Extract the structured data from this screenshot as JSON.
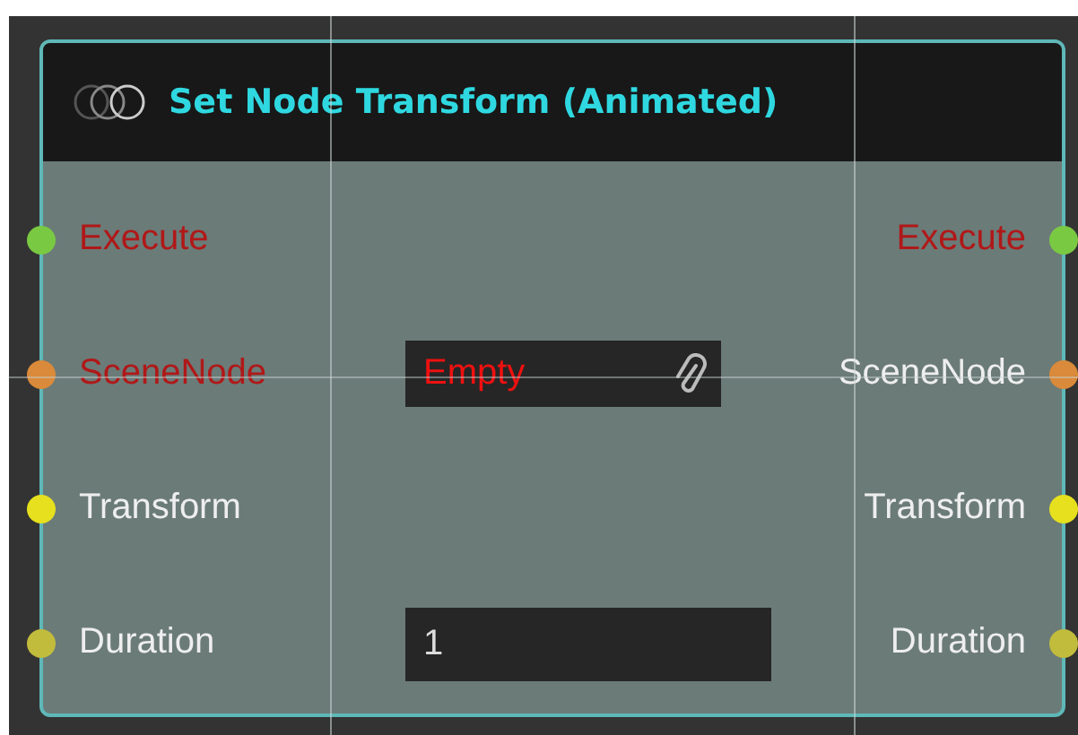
{
  "node": {
    "title": "Set Node Transform (Animated)",
    "rows": [
      {
        "input": {
          "label": "Execute",
          "color": "#7ac943",
          "error": true
        },
        "output": {
          "label": "Execute",
          "color": "#7ac943",
          "error": true
        }
      },
      {
        "input": {
          "label": "SceneNode",
          "color": "#d98a3a",
          "error": true
        },
        "field": {
          "kind": "asset",
          "value": "Empty",
          "empty": true
        },
        "output": {
          "label": "SceneNode",
          "color": "#d98a3a",
          "error": false
        }
      },
      {
        "input": {
          "label": "Transform",
          "color": "#e6e01e",
          "error": false
        },
        "output": {
          "label": "Transform",
          "color": "#e6e01e",
          "error": false
        }
      },
      {
        "input": {
          "label": "Duration",
          "color": "#c2bc3c",
          "error": false
        },
        "field": {
          "kind": "number",
          "value": "1",
          "empty": false
        },
        "output": {
          "label": "Duration",
          "color": "#c2bc3c",
          "error": false
        }
      }
    ]
  }
}
